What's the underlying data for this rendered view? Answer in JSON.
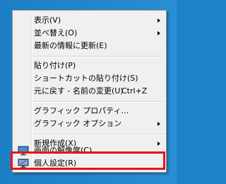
{
  "menu": {
    "items": [
      {
        "label": "表示(V)",
        "shortcut": "",
        "submenu": true
      },
      {
        "label": "並べ替え(O)",
        "shortcut": "",
        "submenu": true
      },
      {
        "label": "最新の情報に更新(E)",
        "shortcut": "",
        "submenu": false
      },
      {
        "label": "貼り付け(P)",
        "shortcut": "",
        "submenu": false
      },
      {
        "label": "ショートカットの貼り付け(S)",
        "shortcut": "",
        "submenu": false
      },
      {
        "label": "元に戻す - 名前の変更(U)",
        "shortcut": "Ctrl+Z",
        "submenu": false
      },
      {
        "label": "グラフィック プロパティ...",
        "shortcut": "",
        "submenu": false
      },
      {
        "label": "グラフィック オプション",
        "shortcut": "",
        "submenu": true
      },
      {
        "label": "新規作成(X)",
        "shortcut": "",
        "submenu": true
      },
      {
        "label": "画面の解像度(C)",
        "shortcut": "",
        "icon": "screen-resolution-icon",
        "submenu": false
      },
      {
        "label": "個人設定(R)",
        "shortcut": "",
        "icon": "personalize-icon",
        "submenu": false
      }
    ]
  },
  "highlight": {
    "target": "個人設定(R)",
    "color": "#e8141e"
  },
  "colors": {
    "desktop": "#1e82c6",
    "menu_background": "#f0f0f0",
    "menu_border": "#979797"
  }
}
